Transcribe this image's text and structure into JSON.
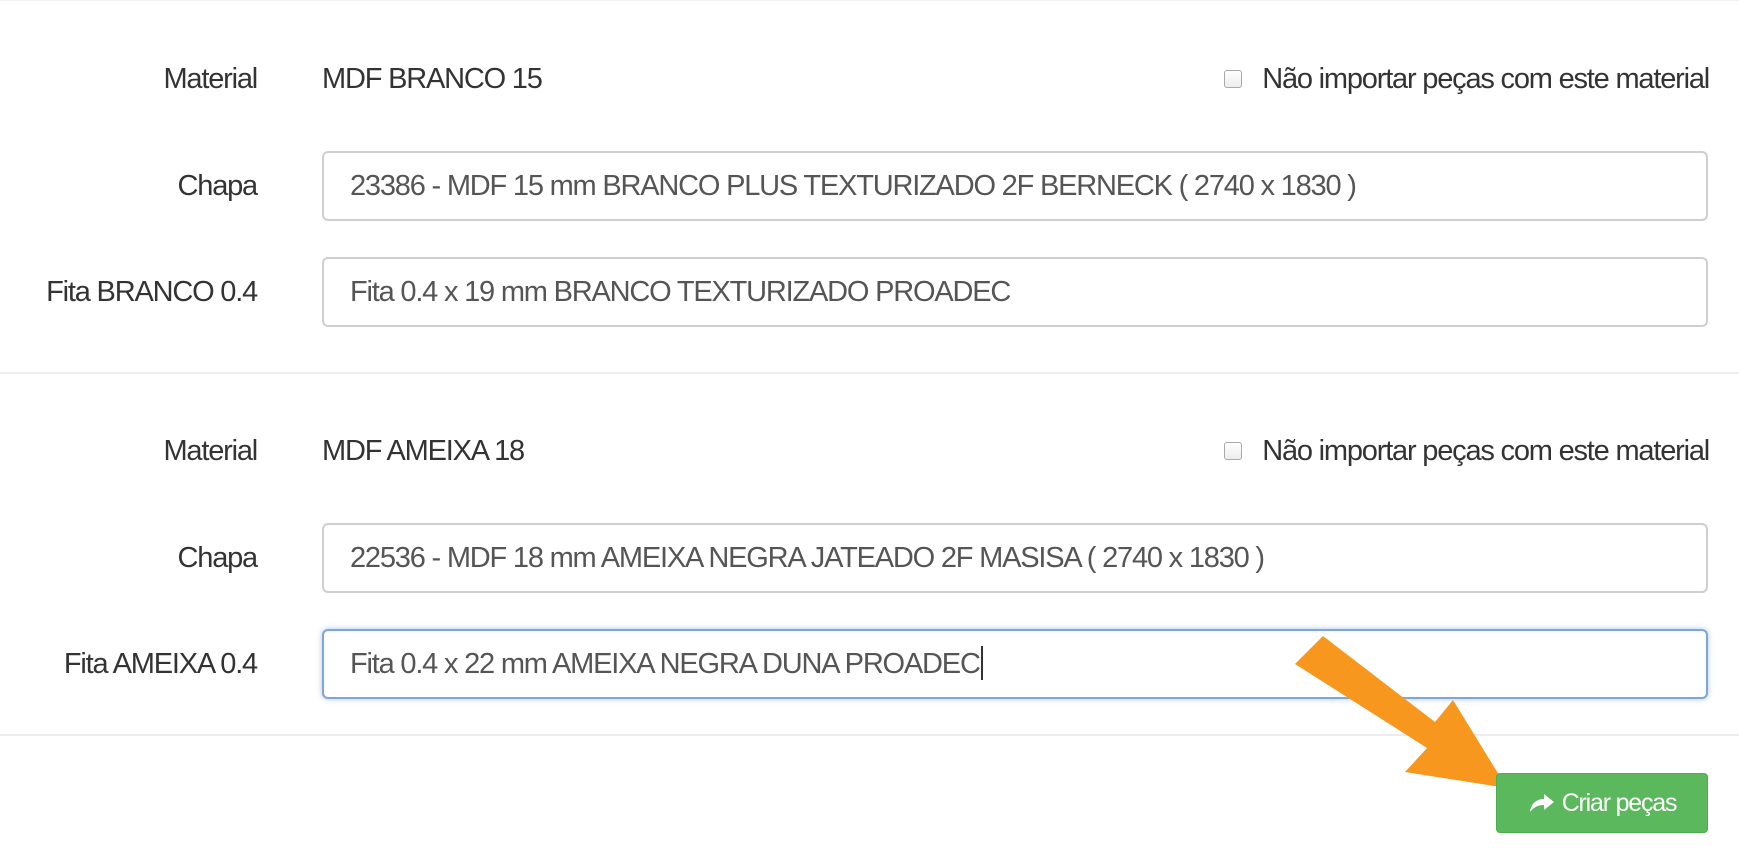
{
  "materials": [
    {
      "material_label": "Material",
      "material_value": "MDF BRANCO 15",
      "skip_label": "Não importar peças com este material",
      "skip_checked": false,
      "sheet_label": "Chapa",
      "sheet_value": "23386 - MDF 15 mm BRANCO PLUS TEXTURIZADO 2F BERNECK ( 2740 x 1830 )",
      "tape_label": "Fita BRANCO 0.4",
      "tape_value": "Fita 0.4 x 19 mm BRANCO TEXTURIZADO PROADEC"
    },
    {
      "material_label": "Material",
      "material_value": "MDF AMEIXA 18",
      "skip_label": "Não importar peças com este material",
      "skip_checked": false,
      "sheet_label": "Chapa",
      "sheet_value": "22536 - MDF 18 mm AMEIXA NEGRA JATEADO 2F MASISA ( 2740 x 1830 )",
      "tape_label": "Fita AMEIXA 0.4",
      "tape_value": "Fita 0.4 x 22 mm AMEIXA NEGRA DUNA PROADEC"
    }
  ],
  "actions": {
    "create_label": "Criar peças",
    "create_icon": "share-arrow-icon"
  },
  "colors": {
    "button_green": "#5cb85c",
    "annotation_orange": "#f7971d",
    "focus_blue": "#7fa6d4"
  }
}
